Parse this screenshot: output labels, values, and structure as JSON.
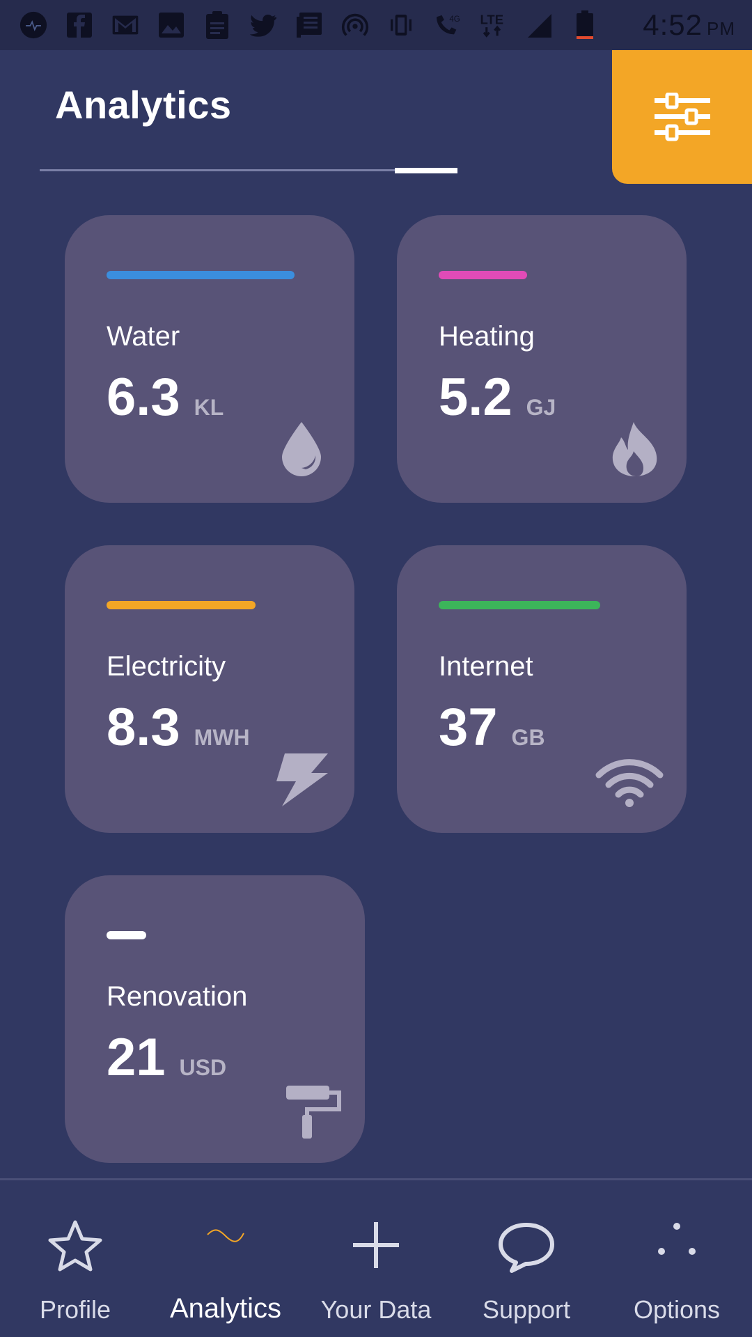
{
  "status_bar": {
    "icons": [
      "equalizer-icon",
      "facebook-icon",
      "gmail-icon",
      "image-icon",
      "clipboard-icon",
      "twitter-icon",
      "news-icon",
      "hotspot-icon",
      "vibrate-icon",
      "wifi-call-icon",
      "lte-icon",
      "signal-icon",
      "battery-icon"
    ],
    "time": "4:52",
    "period": "PM"
  },
  "header": {
    "title": "Analytics",
    "filter_icon": "sliders-icon",
    "filter_color": "#f3a626"
  },
  "cards": [
    {
      "label": "Water",
      "value": "6.3",
      "unit": "KL",
      "accent": "#3b8ede",
      "icon": "water-drop-icon"
    },
    {
      "label": "Heating",
      "value": "5.2",
      "unit": "GJ",
      "accent": "#e04bb7",
      "icon": "flame-icon"
    },
    {
      "label": "Electricity",
      "value": "8.3",
      "unit": "MWH",
      "accent": "#f3a626",
      "icon": "lightning-icon"
    },
    {
      "label": "Internet",
      "value": "37",
      "unit": "GB",
      "accent": "#3cb55a",
      "icon": "wifi-icon"
    },
    {
      "label": "Renovation",
      "value": "21",
      "unit": "USD",
      "accent": "#ffffff",
      "icon": "paint-roller-icon"
    }
  ],
  "bottom_nav": {
    "items": [
      {
        "label": "Profile",
        "icon": "star-icon"
      },
      {
        "label": "Analytics",
        "icon": "wave-icon",
        "active": true
      },
      {
        "label": "Your Data",
        "icon": "plus-icon"
      },
      {
        "label": "Support",
        "icon": "chat-bubble-icon"
      },
      {
        "label": "Options",
        "icon": "dots-icon"
      }
    ]
  }
}
